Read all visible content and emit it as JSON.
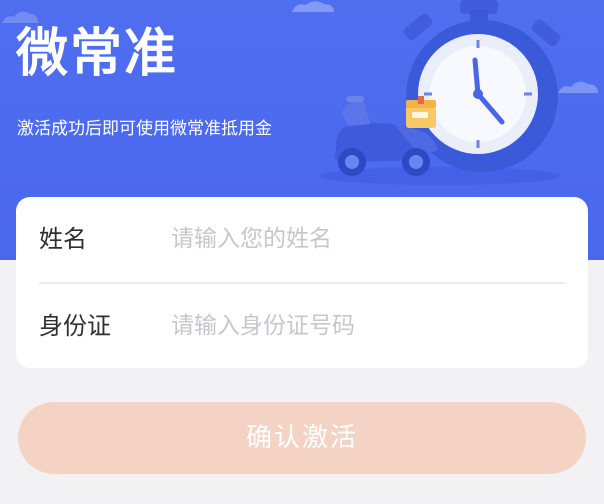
{
  "banner": {
    "title": "微常准",
    "subtitle": "激活成功后即可使用微常准抵用金",
    "background_color": "#4f6ef0"
  },
  "form": {
    "fields": [
      {
        "label": "姓名",
        "placeholder": "请输入您的姓名",
        "value": ""
      },
      {
        "label": "身份证",
        "placeholder": "请输入身份证号码",
        "value": ""
      }
    ]
  },
  "actions": {
    "submit_label": "确认激活",
    "submit_color": "#f5d3c4"
  },
  "illustration": {
    "icons": [
      "stopwatch-icon",
      "scooter-icon",
      "delivery-box-icon",
      "cloud-icon"
    ]
  }
}
